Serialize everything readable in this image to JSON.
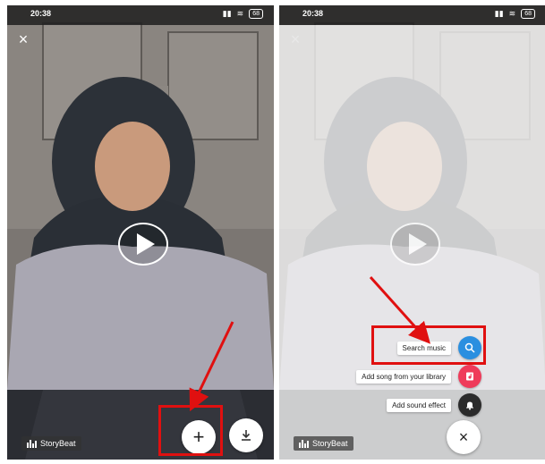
{
  "status_bar": {
    "time": "20:38",
    "battery": "68"
  },
  "brand": {
    "label": "StoryBeat"
  },
  "left_screen": {
    "add_button_symbol": "+",
    "download_icon": "download-icon"
  },
  "right_screen": {
    "menu": [
      {
        "label": "Search music",
        "icon": "search-icon",
        "color": "#2a8fe0"
      },
      {
        "label": "Add song from your library",
        "icon": "library-icon",
        "color": "#ef3b5a"
      },
      {
        "label": "Add sound effect",
        "icon": "bell-icon",
        "color": "#2b2b2b"
      }
    ],
    "close_symbol": "×"
  },
  "annotation_color": "#e01010"
}
